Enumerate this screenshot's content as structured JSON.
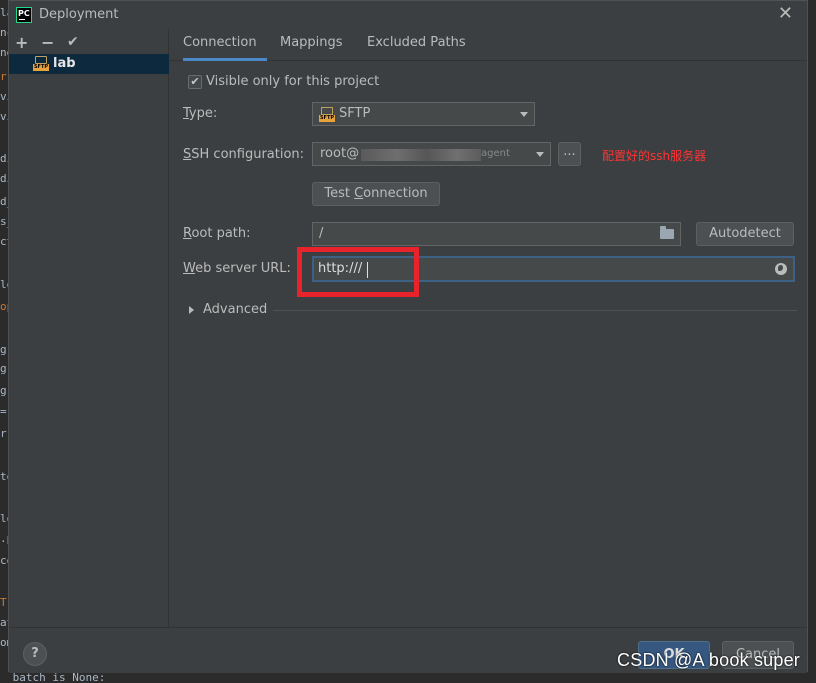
{
  "dialog": {
    "title": "Deployment",
    "app_icon_text": "PC"
  },
  "toolbar": {
    "add": "+",
    "remove": "−",
    "apply": "✔"
  },
  "servers": [
    {
      "label": "lab",
      "icon": "sftp-server-icon",
      "badge": "SFTP"
    }
  ],
  "tabs": [
    "Connection",
    "Mappings",
    "Excluded Paths"
  ],
  "connection": {
    "visible_only_label": "Visible only for this project",
    "visible_only_checked": true,
    "type_label": "Type:",
    "type_value": "SFTP",
    "ssh_label": "SSH configuration:",
    "ssh_value_prefix": "root@",
    "ssh_value_suffix": "agent",
    "ssh_more_button": "...",
    "ssh_annotation": "配置好的ssh服务器",
    "test_connection": "Test Connection",
    "root_path_label": "Root path:",
    "root_path_value": "/",
    "autodetect": "Autodetect",
    "web_url_label": "Web server URL:",
    "web_url_value": "http:///",
    "advanced": "Advanced"
  },
  "footer": {
    "help": "?",
    "ok": "OK",
    "cancel": "Cancel"
  },
  "watermark": "CSDN @A book super",
  "colors": {
    "dialog_bg": "#3c3f41",
    "selection": "#0d293e",
    "tab_underline": "#4a88c7",
    "ok_button": "#365880",
    "annotation_red": "#ff3333",
    "highlight_box": "#e8232b"
  },
  "editor_background_fragments": [
    "_batch is None:"
  ]
}
